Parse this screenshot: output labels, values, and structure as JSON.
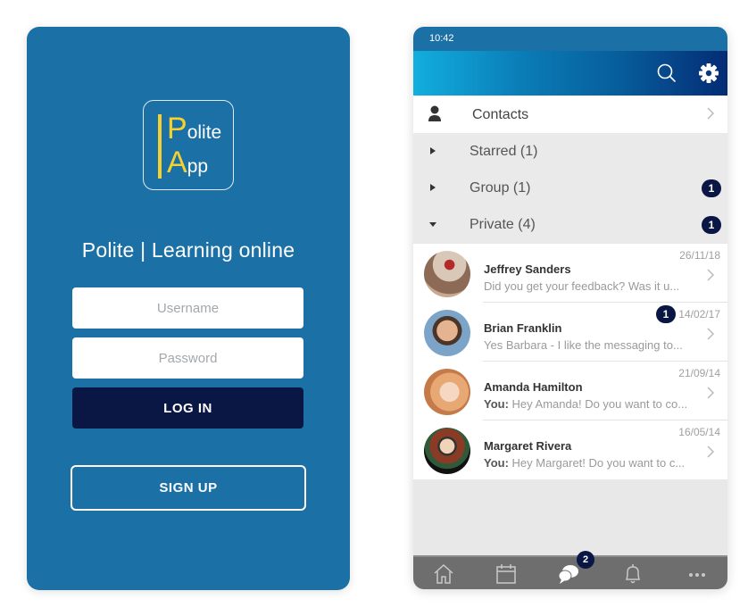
{
  "login": {
    "logo": {
      "line1_big": "P",
      "line1_small": "olite",
      "line2_big": "A",
      "line2_small": "pp"
    },
    "tagline": "Polite | Learning online",
    "username_placeholder": "Username",
    "password_placeholder": "Password",
    "login_label": "LOG IN",
    "signup_label": "SIGN UP"
  },
  "phone": {
    "status_time": "10:42",
    "header": {
      "search_icon": "search-icon",
      "settings_icon": "gear-icon"
    },
    "contacts_label": "Contacts",
    "groups": [
      {
        "label": "Starred (1)",
        "expanded": false,
        "badge": ""
      },
      {
        "label": "Group (1)",
        "expanded": false,
        "badge": "1"
      },
      {
        "label": "Private (4)",
        "expanded": true,
        "badge": "1"
      }
    ],
    "messages": [
      {
        "name": "Jeffrey Sanders",
        "you_prefix": "",
        "preview": "Did you get your feedback? Was it u...",
        "date": "26/11/18",
        "badge": ""
      },
      {
        "name": "Brian Franklin",
        "you_prefix": "",
        "preview": "Yes Barbara - I like the messaging to...",
        "date": "14/02/17",
        "badge": "1"
      },
      {
        "name": "Amanda Hamilton",
        "you_prefix": "You:",
        "preview": " Hey Amanda! Do you want to co...",
        "date": "21/09/14",
        "badge": ""
      },
      {
        "name": "Margaret Rivera",
        "you_prefix": "You:",
        "preview": " Hey Margaret! Do you want to c...",
        "date": "16/05/14",
        "badge": ""
      }
    ],
    "tabs": [
      {
        "name": "home-icon"
      },
      {
        "name": "calendar-icon"
      },
      {
        "name": "messages-icon",
        "badge": "2"
      },
      {
        "name": "bell-icon"
      },
      {
        "name": "more-icon"
      }
    ],
    "colors": {
      "brand_blue": "#1b70a5",
      "navy": "#0a1744",
      "logo_yellow": "#f5d130"
    }
  }
}
